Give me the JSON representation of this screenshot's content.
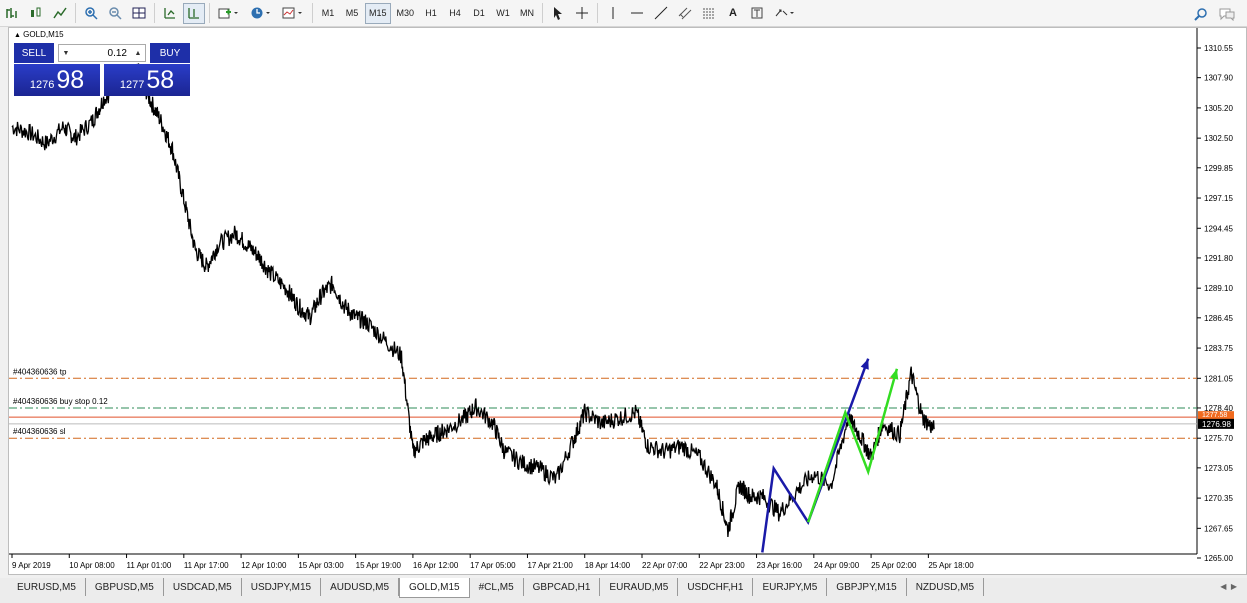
{
  "toolbar": {
    "timeframes": [
      "M1",
      "M5",
      "M15",
      "M30",
      "H1",
      "H4",
      "D1",
      "W1",
      "MN"
    ],
    "active_timeframe": "M15",
    "text_tool": "A"
  },
  "chart": {
    "symbol": "GOLD,M15",
    "sell_label": "SELL",
    "buy_label": "BUY",
    "lot": "0.12",
    "bid_small": "1276",
    "bid_big": "98",
    "ask_small": "1277",
    "ask_big": "58",
    "current_price": "1276.98",
    "ask_line_price": "1277.58",
    "colors": {
      "price_tag": "#f06a1e",
      "order_line": "#d2691e",
      "stop_line": "#2e8b57",
      "zigzag_blue": "#1a1aa8",
      "zigzag_green": "#33dd22"
    }
  },
  "chart_data": {
    "type": "line",
    "title": "GOLD,M15",
    "ylim": [
      1264.0,
      1312.0
    ],
    "y_ticks": [
      "1310.55",
      "1307.90",
      "1305.20",
      "1302.50",
      "1299.85",
      "1297.15",
      "1294.45",
      "1291.80",
      "1289.10",
      "1286.45",
      "1283.75",
      "1281.05",
      "1278.40",
      "1275.70",
      "1273.05",
      "1270.35",
      "1267.65",
      "1265.00"
    ],
    "x_ticks": [
      "9 Apr 2019",
      "10 Apr 08:00",
      "11 Apr 01:00",
      "11 Apr 17:00",
      "12 Apr 10:00",
      "15 Apr 03:00",
      "15 Apr 19:00",
      "16 Apr 12:00",
      "17 Apr 05:00",
      "17 Apr 21:00",
      "18 Apr 14:00",
      "22 Apr 07:00",
      "22 Apr 23:00",
      "23 Apr 16:00",
      "24 Apr 09:00",
      "25 Apr 02:00",
      "25 Apr 18:00"
    ],
    "x_pos": [
      0,
      1,
      2,
      3,
      4,
      5,
      6,
      7,
      8,
      9,
      10,
      11,
      12,
      13,
      14,
      15,
      16
    ],
    "series": [
      {
        "x": [
          0,
          0.3,
          0.6,
          0.9,
          1.1,
          1.4,
          1.6,
          1.9,
          2.2,
          2.4,
          2.6,
          2.8,
          3.0,
          3.2,
          3.4,
          3.6,
          3.9,
          4.1,
          4.3,
          4.5,
          4.8,
          5.0,
          5.2,
          5.4,
          5.6,
          5.8,
          6.0,
          6.2,
          6.5,
          6.8,
          7.0,
          7.2,
          7.4,
          7.6,
          7.9,
          8.1,
          8.4,
          8.6,
          8.9,
          9.2,
          9.5,
          9.8,
          10.0,
          10.3,
          10.6,
          10.9,
          11.1,
          11.4,
          11.7,
          12.0,
          12.3,
          12.5,
          12.7,
          12.9,
          13.1,
          13.4,
          13.7,
          14.0,
          14.3,
          14.6,
          14.8,
          15.0,
          15.2,
          15.5,
          15.7,
          15.9,
          16.1
        ],
        "values": [
          1303.5,
          1303.0,
          1302.0,
          1303.5,
          1302.5,
          1304.0,
          1306.0,
          1307.5,
          1308.5,
          1306.0,
          1304.0,
          1301.5,
          1297.0,
          1292.5,
          1291.0,
          1293.0,
          1294.0,
          1293.0,
          1292.0,
          1290.5,
          1289.0,
          1287.5,
          1286.5,
          1288.5,
          1289.5,
          1287.5,
          1286.5,
          1286.0,
          1284.5,
          1283.0,
          1274.5,
          1275.5,
          1276.0,
          1276.5,
          1277.5,
          1278.5,
          1277.0,
          1274.5,
          1273.5,
          1273.0,
          1272.0,
          1275.5,
          1278.0,
          1277.0,
          1277.5,
          1278.0,
          1275.0,
          1274.5,
          1275.0,
          1274.0,
          1271.5,
          1267.5,
          1271.5,
          1270.5,
          1270.5,
          1269.0,
          1271.0,
          1272.5,
          1271.5,
          1277.5,
          1276.0,
          1274.0,
          1277.0,
          1276.0,
          1281.5,
          1277.5,
          1276.5
        ]
      }
    ],
    "order_lines": [
      {
        "label": "#404360636 tp",
        "value": 1281.05
      },
      {
        "label": "#404360636 buy stop 0.12",
        "value": 1278.4
      },
      {
        "label": "#404360636 sl",
        "value": 1275.7
      }
    ],
    "zigzag_blue": {
      "x": [
        13.1,
        13.3,
        13.9,
        14.95
      ],
      "values": [
        1265.5,
        1273.0,
        1268.2,
        1282.8
      ]
    },
    "zigzag_green": {
      "x": [
        13.9,
        14.55,
        14.95,
        15.45
      ],
      "values": [
        1268.2,
        1278.0,
        1272.7,
        1281.9
      ]
    }
  },
  "tabs": {
    "items": [
      "EURUSD,M5",
      "GBPUSD,M5",
      "USDCAD,M5",
      "USDJPY,M15",
      "AUDUSD,M5",
      "GOLD,M15",
      "#CL,M5",
      "GBPCAD,H1",
      "EURAUD,M5",
      "USDCHF,H1",
      "EURJPY,M5",
      "GBPJPY,M15",
      "NZDUSD,M5"
    ],
    "active": "GOLD,M15"
  }
}
